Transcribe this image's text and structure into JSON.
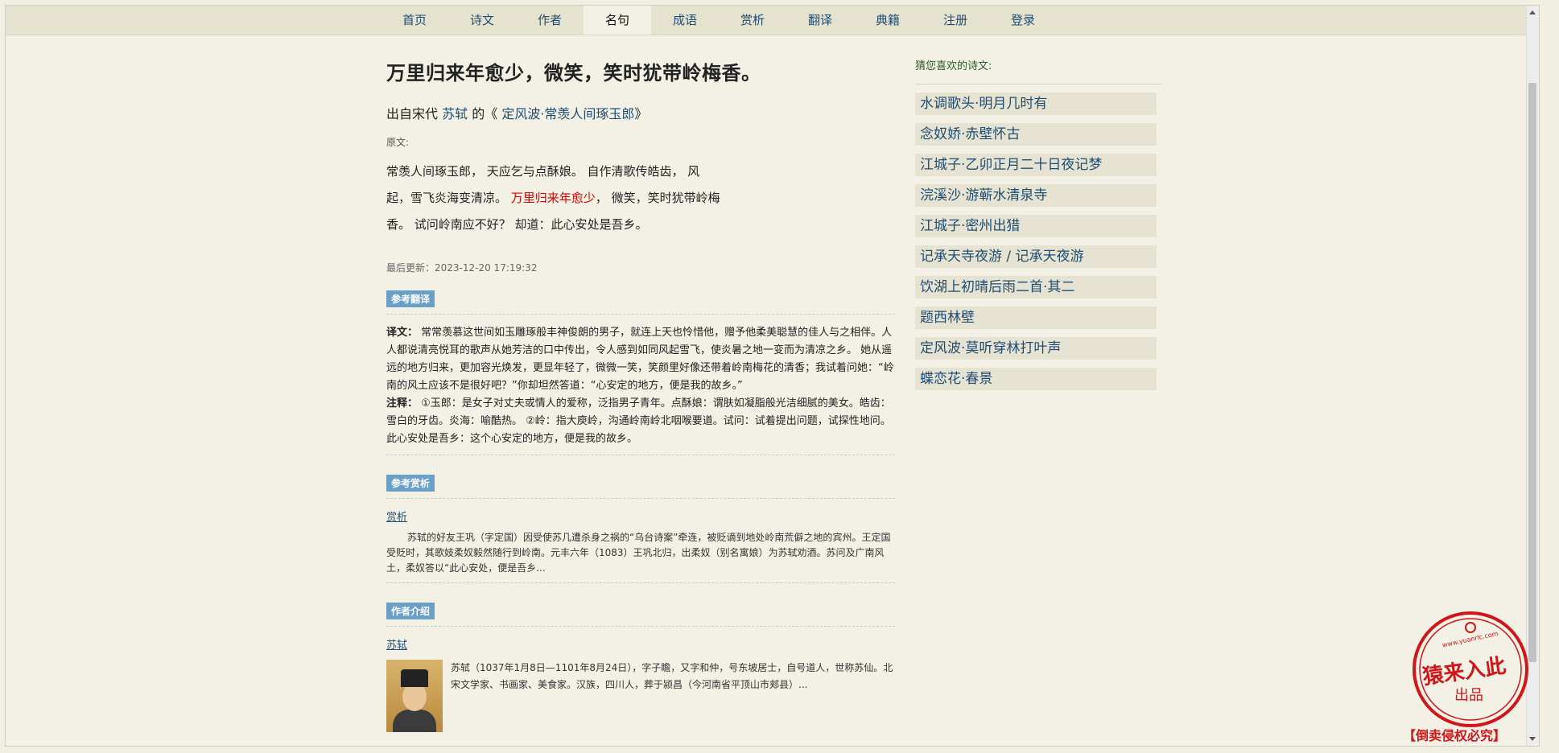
{
  "nav": [
    "首页",
    "诗文",
    "作者",
    "名句",
    "成语",
    "赏析",
    "翻译",
    "典籍",
    "注册",
    "登录"
  ],
  "nav_active": "名句",
  "sentence": "万里归来年愈少，微笑，笑时犹带岭梅香。",
  "source": {
    "prefix": "出自宋代",
    "author": "苏轼",
    "mid": "的《",
    "title": "定风波·常羡人间琢玉郎",
    "suffix": "》"
  },
  "original_label": "原文:",
  "poem": {
    "line1": "常羡人间琢玉郎， 天应乞与点酥娘。 自作清歌传皓齿， 风",
    "line2a": "起，雪飞炎海变清凉。 ",
    "highlight": "万里归来年愈少",
    "line2b": "， 微笑，笑时犹带岭梅",
    "line3": "香。 试问岭南应不好？ 却道：此心安处是吾乡。"
  },
  "update": "最后更新：2023-12-20 17:19:32",
  "translation": {
    "tag": "参考翻译",
    "yiwen_label": "译文：",
    "yiwen": "常常羡慕这世间如玉雕琢般丰神俊朗的男子，就连上天也怜惜他，赠予他柔美聪慧的佳人与之相伴。人人都说清亮悦耳的歌声从她芳洁的口中传出，令人感到如同风起雪飞，使炎暑之地一变而为清凉之乡。 她从遥远的地方归来，更加容光焕发，更显年轻了，微微一笑，笑颜里好像还带着岭南梅花的清香；我试着问她：“岭南的风土应该不是很好吧？”你却坦然答道：“心安定的地方，便是我的故乡。”",
    "zhushi_label": "注释：",
    "zhushi": "①玉郎：是女子对丈夫或情人的爱称，泛指男子青年。点酥娘：谓肤如凝脂般光洁细腻的美女。皓齿：雪白的牙齿。炎海：喻酷热。 ②岭：指大庾岭，沟通岭南岭北咽喉要道。试问：试着提出问题，试探性地问。此心安处是吾乡：这个心安定的地方，便是我的故乡。"
  },
  "appreciation": {
    "tag": "参考赏析",
    "sub": "赏析",
    "text": "苏轼的好友王巩（字定国）因受使苏几遭杀身之祸的“乌台诗案”牵连，被贬谪到地处岭南荒僻之地的宾州。王定国受贬时，其歌妓柔奴毅然随行到岭南。元丰六年（1083）王巩北归，出柔奴（别名寓娘）为苏轼劝酒。苏问及广南风土，柔奴答以“此心安处，便是吾乡..."
  },
  "author": {
    "tag": "作者介绍",
    "name": "苏轼",
    "desc": "苏轼（1037年1月8日—1101年8月24日），字子瞻，又字和仲，号东坡居士，自号道人，世称苏仙。北宋文学家、书画家、美食家。汉族，四川人，葬于颍昌（今河南省平顶山市郏县）..."
  },
  "sidebar": {
    "title": "猜您喜欢的诗文:",
    "items": [
      "水调歌头·明月几时有",
      "念奴娇·赤壁怀古",
      "江城子·乙卯正月二十日夜记梦",
      "浣溪沙·游蕲水清泉寺",
      "江城子·密州出猎",
      "记承天寺夜游 / 记承天夜游",
      "饮湖上初晴后雨二首·其二",
      "题西林壁",
      "定风波·莫听穿林打叶声",
      "蝶恋花·春景"
    ]
  },
  "seal": {
    "top": "www.yuanrlc.com",
    "main": "猿来入此",
    "sub": "出品",
    "bottom": "【倒卖侵权必究】"
  },
  "colors": {
    "accent": "#1f4d72",
    "highlight": "#dd0000",
    "tag": "#6a9fc8",
    "seal": "#d0161b"
  }
}
